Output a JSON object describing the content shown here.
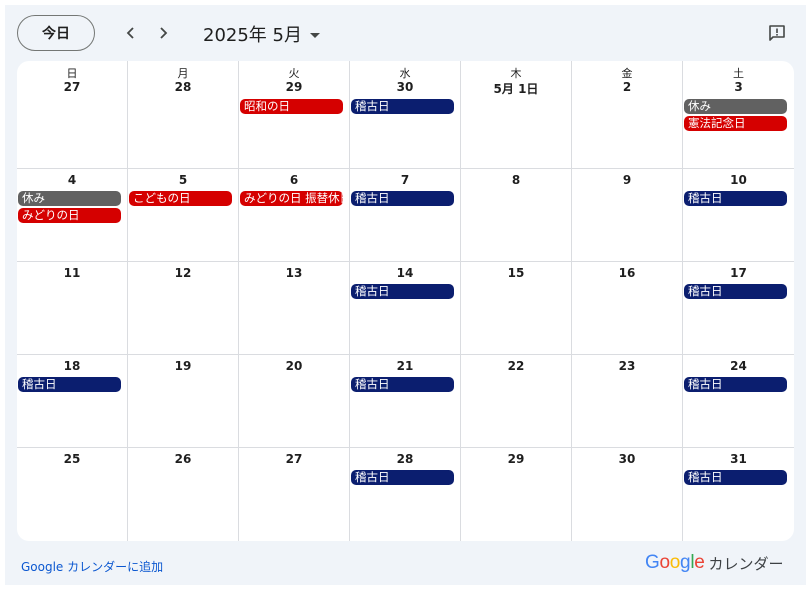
{
  "header": {
    "today_label": "今日",
    "month_title": "2025年 5月"
  },
  "weekdays": [
    "日",
    "月",
    "火",
    "水",
    "木",
    "金",
    "土"
  ],
  "weeks": [
    [
      "27",
      "28",
      "29",
      "30",
      "5月 1日",
      "2",
      "3"
    ],
    [
      "4",
      "5",
      "6",
      "7",
      "8",
      "9",
      "10"
    ],
    [
      "11",
      "12",
      "13",
      "14",
      "15",
      "16",
      "17"
    ],
    [
      "18",
      "19",
      "20",
      "21",
      "22",
      "23",
      "24"
    ],
    [
      "25",
      "26",
      "27",
      "28",
      "29",
      "30",
      "31"
    ]
  ],
  "events": [
    {
      "week": 0,
      "day": 2,
      "slot": 0,
      "label": "昭和の日",
      "color": "#d50000"
    },
    {
      "week": 0,
      "day": 3,
      "slot": 0,
      "label": "稽古日",
      "color": "#0b1e6f"
    },
    {
      "week": 0,
      "day": 6,
      "slot": 0,
      "label": "休み",
      "color": "#616161"
    },
    {
      "week": 0,
      "day": 6,
      "slot": 1,
      "label": "憲法記念日",
      "color": "#d50000"
    },
    {
      "week": 1,
      "day": 0,
      "slot": 0,
      "label": "休み",
      "color": "#616161"
    },
    {
      "week": 1,
      "day": 0,
      "slot": 1,
      "label": "みどりの日",
      "color": "#d50000"
    },
    {
      "week": 1,
      "day": 1,
      "slot": 0,
      "label": "こどもの日",
      "color": "#d50000"
    },
    {
      "week": 1,
      "day": 2,
      "slot": 0,
      "label": "みどりの日 振替休日",
      "color": "#d50000"
    },
    {
      "week": 1,
      "day": 3,
      "slot": 0,
      "label": "稽古日",
      "color": "#0b1e6f"
    },
    {
      "week": 1,
      "day": 6,
      "slot": 0,
      "label": "稽古日",
      "color": "#0b1e6f"
    },
    {
      "week": 2,
      "day": 3,
      "slot": 0,
      "label": "稽古日",
      "color": "#0b1e6f"
    },
    {
      "week": 2,
      "day": 6,
      "slot": 0,
      "label": "稽古日",
      "color": "#0b1e6f"
    },
    {
      "week": 3,
      "day": 0,
      "slot": 0,
      "label": "稽古日",
      "color": "#0b1e6f"
    },
    {
      "week": 3,
      "day": 3,
      "slot": 0,
      "label": "稽古日",
      "color": "#0b1e6f"
    },
    {
      "week": 3,
      "day": 6,
      "slot": 0,
      "label": "稽古日",
      "color": "#0b1e6f"
    },
    {
      "week": 4,
      "day": 3,
      "slot": 0,
      "label": "稽古日",
      "color": "#0b1e6f"
    },
    {
      "week": 4,
      "day": 6,
      "slot": 0,
      "label": "稽古日",
      "color": "#0b1e6f"
    }
  ],
  "footer": {
    "add_link": "Google カレンダーに追加",
    "logo_word": "Google",
    "logo_suffix": "カレンダー",
    "logo_colors": [
      "#4285f4",
      "#ea4335",
      "#fbbc05",
      "#4285f4",
      "#34a853",
      "#ea4335"
    ]
  }
}
